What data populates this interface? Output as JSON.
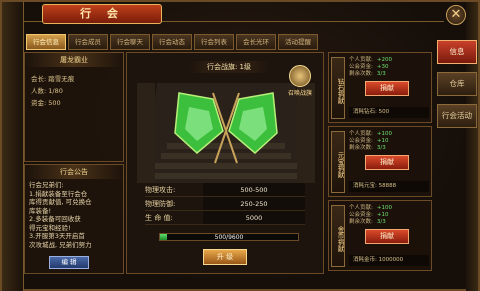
{
  "window": {
    "title": "行 会",
    "close_glyph": "✕"
  },
  "tabs": [
    {
      "label": "行会信息",
      "active": true
    },
    {
      "label": "行会成员",
      "active": false
    },
    {
      "label": "行会聊天",
      "active": false
    },
    {
      "label": "行会动态",
      "active": false
    },
    {
      "label": "行会列表",
      "active": false
    },
    {
      "label": "会长光环",
      "active": false
    },
    {
      "label": "活动提醒",
      "active": false
    }
  ],
  "guild": {
    "name": "屠龙霸业",
    "leader_line": "会长: 踏雪无痕",
    "level_line": "人数: 1/80",
    "funds_line": "资金: 500"
  },
  "notice": {
    "title": "行会公告",
    "text_lines": [
      "行会兄弟们:",
      "1.捐献装备至行会仓",
      "库得贡献值, 可兑换仓",
      "库装备!",
      "2.多装备可回收获",
      "得元宝和经验!",
      "3.开服第3天开启首",
      "次攻城战, 兄弟们努力"
    ],
    "edit_label": "编 辑"
  },
  "flag": {
    "title": "行会战旗: 1级",
    "summon_label": "召唤战旗",
    "stats": [
      {
        "label": "物理攻击:",
        "value": "500-500"
      },
      {
        "label": "物理防御:",
        "value": "250-250"
      },
      {
        "label": "生 命 值:",
        "value": "5000"
      }
    ],
    "exp_text": "500/9600",
    "exp_progress": 0.052,
    "upgrade_label": "升 级"
  },
  "donations": [
    {
      "tag": "钻石捐献",
      "lines": [
        [
          "个人贡献:",
          "+200"
        ],
        [
          "公会资金:",
          "+30"
        ],
        [
          "剩余次数:",
          "3/3"
        ]
      ],
      "button": "捐献",
      "cost": "消耗钻石:   500"
    },
    {
      "tag": "元宝捐献",
      "lines": [
        [
          "个人贡献:",
          "+100"
        ],
        [
          "公会资金:",
          "+10"
        ],
        [
          "剩余次数:",
          "3/3"
        ]
      ],
      "button": "捐献",
      "cost": "消耗元宝:   58888"
    },
    {
      "tag": "金币捐献",
      "lines": [
        [
          "个人贡献:",
          "+100"
        ],
        [
          "公会资金:",
          "+10"
        ],
        [
          "剩余次数:",
          "3/3"
        ]
      ],
      "button": "捐献",
      "cost": "消耗金币:   1000000"
    }
  ],
  "side_menu": [
    {
      "label": "信息",
      "active": true
    },
    {
      "label": "仓库",
      "active": false
    },
    {
      "label": "行会活动",
      "active": false
    }
  ]
}
